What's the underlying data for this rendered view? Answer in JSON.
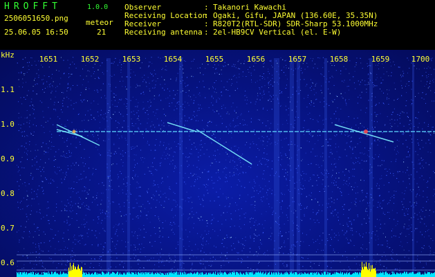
{
  "app": {
    "name": "HROFFT",
    "version": "1.0.0"
  },
  "file": {
    "name": "2506051650.png",
    "timestamp": "25.06.05 16:50"
  },
  "meteor": {
    "label": "meteor",
    "count": "21"
  },
  "info": [
    {
      "label": "Observer",
      "value": "Takanori Kawachi"
    },
    {
      "label": "Receiving Location",
      "value": "Ogaki, Gifu, JAPAN (136.60E, 35.35N)"
    },
    {
      "label": "Receiver",
      "value": "R820T2(RTL-SDR) SDR-Sharp 53.1000MHz"
    },
    {
      "label": "Receiving antenna",
      "value": "2el-HB9CV Vertical (el. E-W)"
    }
  ],
  "separator": ":",
  "axes": {
    "x_ticks": [
      "1651",
      "1652",
      "1653",
      "1654",
      "1655",
      "1656",
      "1657",
      "1658",
      "1659",
      "1700"
    ],
    "y_unit": "kHz",
    "y_ticks": [
      "1.1",
      "1.0",
      "0.9",
      "0.8",
      "0.7",
      "0.6"
    ]
  },
  "colors": {
    "background": "#06127e",
    "text": "#ffff33",
    "title": "#33ff33",
    "baseline_signal": "#00e5ff",
    "meteor_burst": "#ffff00"
  }
}
